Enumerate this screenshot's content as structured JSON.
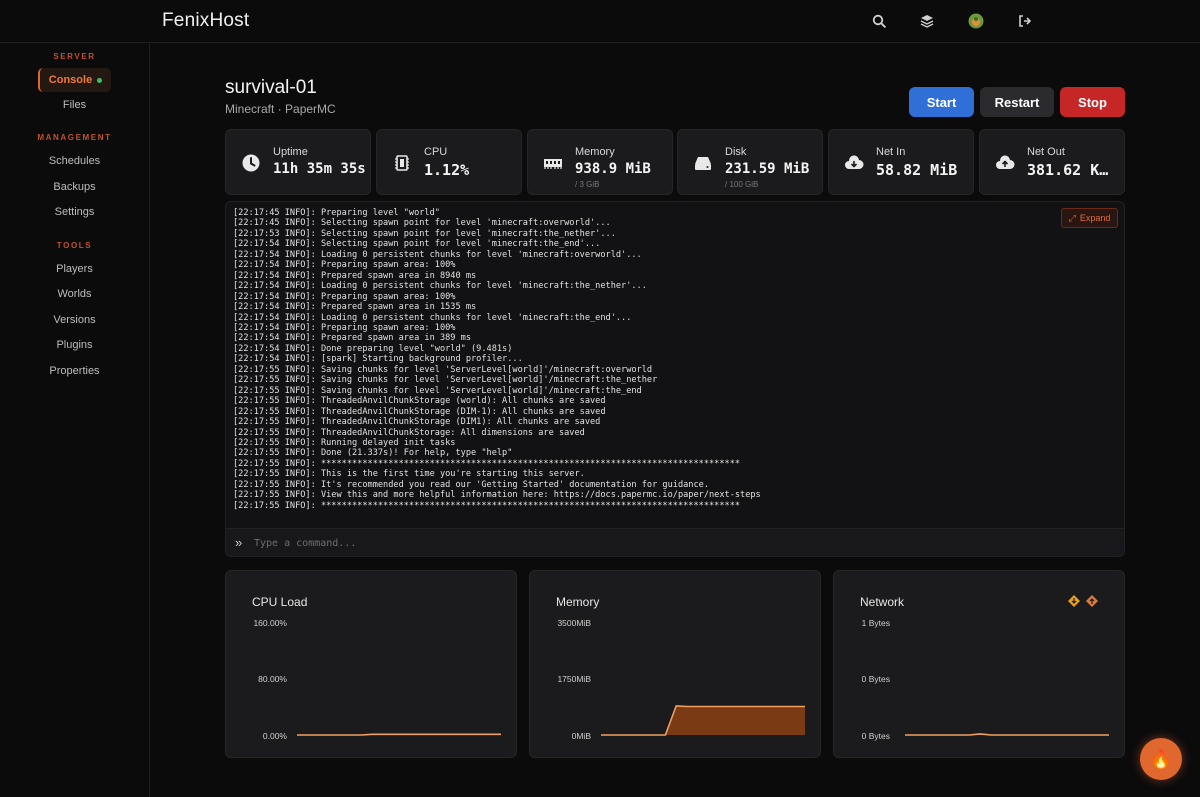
{
  "app": {
    "brand": "FenixHost"
  },
  "topbar": {
    "icons": [
      "search-icon",
      "layers-icon",
      "avatar",
      "logout-icon"
    ]
  },
  "sidebar": {
    "sections": {
      "server": "SERVER",
      "management": "MANAGEMENT",
      "tools": "TOOLS"
    },
    "active": "Console",
    "server_items": [
      "Console",
      "Files"
    ],
    "management_items": [
      "Schedules",
      "Backups",
      "Settings"
    ],
    "tools_items": [
      "Players",
      "Worlds",
      "Versions",
      "Plugins",
      "Properties"
    ]
  },
  "server": {
    "name": "survival-01",
    "subtitle": "Minecraft · PaperMC"
  },
  "actions": {
    "start": "Start",
    "restart": "Restart",
    "stop": "Stop",
    "colors": {
      "start": "#2f6fd6",
      "restart": "#2b2b2e",
      "stop": "#c72626"
    }
  },
  "stats": [
    {
      "label": "Uptime",
      "value": "11h 35m 35s",
      "sub": "",
      "icon": "clock-icon"
    },
    {
      "label": "CPU",
      "value": "1.12%",
      "sub": "",
      "icon": "cpu-icon"
    },
    {
      "label": "Memory",
      "value": "938.9 MiB",
      "sub": "/ 3 GiB",
      "icon": "memory-icon"
    },
    {
      "label": "Disk",
      "value": "231.59 MiB",
      "sub": "/ 100 GiB",
      "icon": "disk-icon"
    },
    {
      "label": "Net In",
      "value": "58.82 MiB",
      "sub": "",
      "icon": "cloud-download-icon"
    },
    {
      "label": "Net Out",
      "value": "381.62 K…",
      "sub": "",
      "icon": "cloud-upload-icon"
    }
  ],
  "console": {
    "expand_label": "Expand",
    "input_placeholder": "Type a command...",
    "lines": [
      "[22:17:45 INFO]: Preparing level \"world\"",
      "[22:17:45 INFO]: Selecting spawn point for level 'minecraft:overworld'...",
      "[22:17:53 INFO]: Selecting spawn point for level 'minecraft:the_nether'...",
      "[22:17:54 INFO]: Selecting spawn point for level 'minecraft:the_end'...",
      "[22:17:54 INFO]: Loading 0 persistent chunks for level 'minecraft:overworld'...",
      "[22:17:54 INFO]: Preparing spawn area: 100%",
      "[22:17:54 INFO]: Prepared spawn area in 8940 ms",
      "[22:17:54 INFO]: Loading 0 persistent chunks for level 'minecraft:the_nether'...",
      "[22:17:54 INFO]: Preparing spawn area: 100%",
      "[22:17:54 INFO]: Prepared spawn area in 1535 ms",
      "[22:17:54 INFO]: Loading 0 persistent chunks for level 'minecraft:the_end'...",
      "[22:17:54 INFO]: Preparing spawn area: 100%",
      "[22:17:54 INFO]: Prepared spawn area in 389 ms",
      "[22:17:54 INFO]: Done preparing level \"world\" (9.481s)",
      "[22:17:54 INFO]: [spark] Starting background profiler...",
      "[22:17:55 INFO]: Saving chunks for level 'ServerLevel[world]'/minecraft:overworld",
      "[22:17:55 INFO]: Saving chunks for level 'ServerLevel[world]'/minecraft:the_nether",
      "[22:17:55 INFO]: Saving chunks for level 'ServerLevel[world]'/minecraft:the_end",
      "[22:17:55 INFO]: ThreadedAnvilChunkStorage (world): All chunks are saved",
      "[22:17:55 INFO]: ThreadedAnvilChunkStorage (DIM-1): All chunks are saved",
      "[22:17:55 INFO]: ThreadedAnvilChunkStorage (DIM1): All chunks are saved",
      "[22:17:55 INFO]: ThreadedAnvilChunkStorage: All dimensions are saved",
      "[22:17:55 INFO]: Running delayed init tasks",
      "[22:17:55 INFO]: Done (21.337s)! For help, type \"help\"",
      "[22:17:55 INFO]: *********************************************************************************",
      "[22:17:55 INFO]: This is the first time you're starting this server.",
      "[22:17:55 INFO]: It's recommended you read our 'Getting Started' documentation for guidance.",
      "[22:17:55 INFO]: View this and more helpful information here: https://docs.papermc.io/paper/next-steps",
      "[22:17:55 INFO]: *********************************************************************************"
    ]
  },
  "charts": {
    "cpu": {
      "title": "CPU Load",
      "ticks": [
        "160.00%",
        "80.00%",
        "0.00%"
      ]
    },
    "memory": {
      "title": "Memory",
      "ticks": [
        "3500MiB",
        "1750MiB",
        "0MiB"
      ]
    },
    "network": {
      "title": "Network",
      "ticks": [
        "1 Bytes",
        "0 Bytes",
        "0 Bytes"
      ],
      "legend_icons": [
        "download-icon",
        "upload-icon"
      ]
    }
  },
  "chart_data": [
    {
      "type": "area",
      "title": "CPU Load",
      "ylim": [
        0,
        160
      ],
      "x": [
        0,
        1,
        2,
        3,
        4,
        5,
        6,
        7,
        8,
        9,
        10,
        11,
        12,
        13,
        14,
        15,
        16,
        17,
        18,
        19
      ],
      "values": [
        0,
        0,
        0,
        0,
        0,
        0,
        0,
        1,
        1,
        1,
        1,
        1,
        1,
        1,
        1,
        1,
        1,
        1,
        1,
        1
      ],
      "color": "#f0a060"
    },
    {
      "type": "area",
      "title": "Memory",
      "ylim": [
        0,
        3500
      ],
      "x": [
        0,
        1,
        2,
        3,
        4,
        5,
        6,
        7,
        8,
        9,
        10,
        11,
        12,
        13,
        14,
        15,
        16,
        17,
        18,
        19
      ],
      "values": [
        0,
        0,
        0,
        0,
        0,
        0,
        0,
        960,
        940,
        940,
        940,
        940,
        940,
        940,
        940,
        940,
        940,
        940,
        940,
        940
      ],
      "color": "#f0a060"
    },
    {
      "type": "area",
      "title": "Network",
      "ylim": [
        0,
        1
      ],
      "x": [
        0,
        1,
        2,
        3,
        4,
        5,
        6,
        7,
        8,
        9,
        10,
        11,
        12,
        13,
        14,
        15,
        16,
        17,
        18,
        19
      ],
      "values": [
        0,
        0,
        0,
        0,
        0,
        0,
        0,
        0.01,
        0,
        0,
        0,
        0,
        0,
        0,
        0,
        0,
        0,
        0,
        0,
        0
      ],
      "color": "#f0a060"
    }
  ],
  "accent": "#e0672e"
}
